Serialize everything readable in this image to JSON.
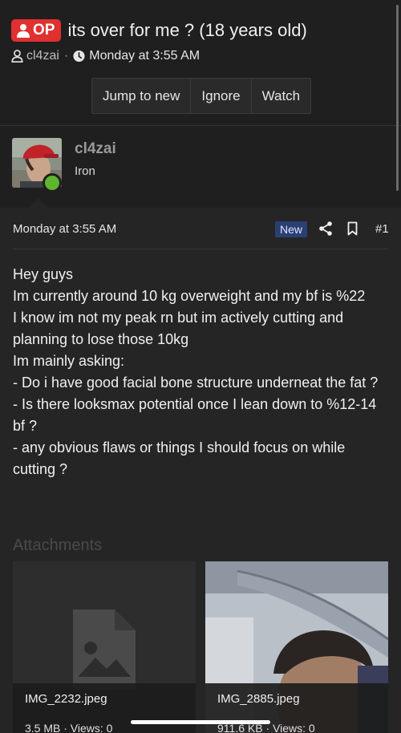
{
  "thread": {
    "op_badge": "OP",
    "title": "its over for me ? (18 years old)",
    "author": "cl4zai",
    "separator": "·",
    "date": "Monday at 3:55 AM"
  },
  "actions": {
    "jump_to_new": "Jump to new",
    "ignore": "Ignore",
    "watch": "Watch"
  },
  "user": {
    "name": "cl4zai",
    "title": "Iron",
    "online_color": "#5fb52d"
  },
  "post": {
    "date": "Monday at 3:55 AM",
    "new_badge": "New",
    "number": "#1",
    "lines": [
      "Hey guys",
      "Im currently around 10 kg overweight and my bf is %22",
      "I know im not my peak rn but im actively cutting and planning to lose those 10kg",
      "Im mainly asking:",
      "- Do i have good facial bone structure underneat the fat ?",
      "- Is there looksmax potential once I lean down to %12-14 bf ?",
      "- any obvious flaws or things I should focus on while cutting ?"
    ]
  },
  "attachments": {
    "label": "Attachments",
    "items": [
      {
        "name": "IMG_2232.jpeg",
        "meta": "3.5 MB · Views: 0"
      },
      {
        "name": "IMG_2885.jpeg",
        "meta": "911.6 KB · Views: 0"
      }
    ]
  },
  "colors": {
    "op_badge": "#e0302f",
    "new_badge": "#2a3f73",
    "background": "#1f1f1f",
    "post_background": "#252525"
  }
}
